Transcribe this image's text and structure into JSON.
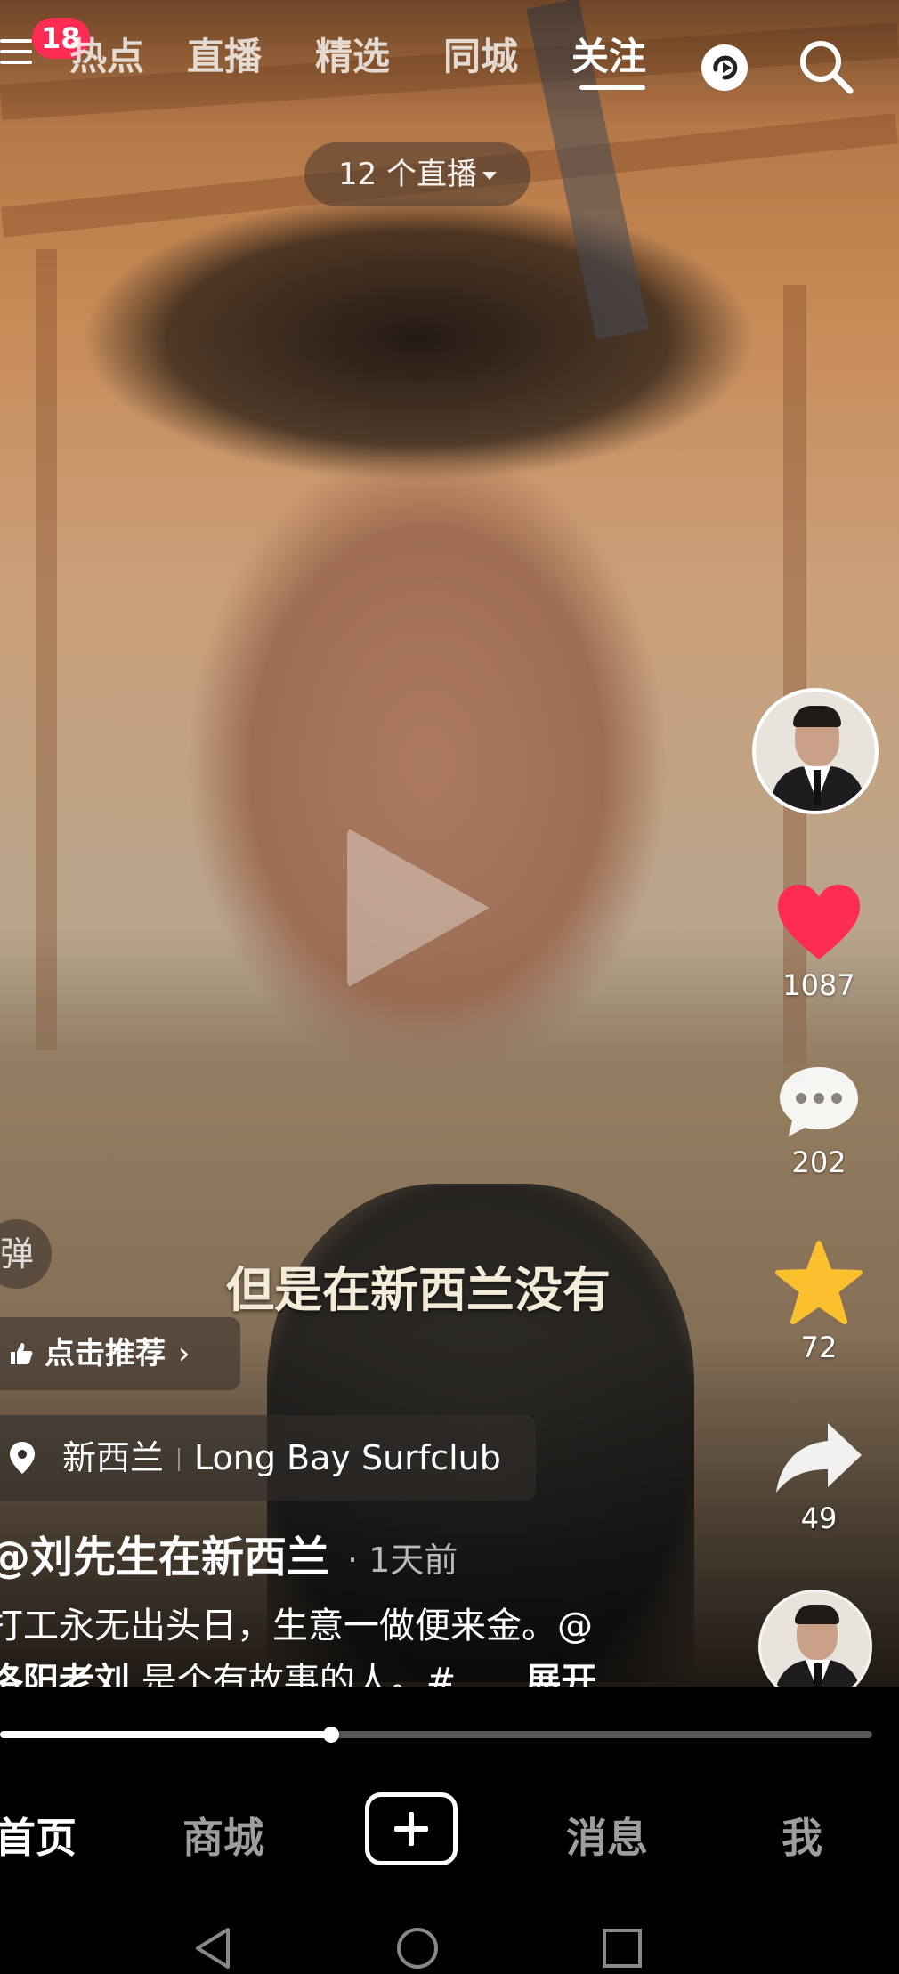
{
  "top_bar": {
    "notification_count": "18",
    "tabs": [
      {
        "label": "热点",
        "active": false
      },
      {
        "label": "直播",
        "active": false
      },
      {
        "label": "精选",
        "active": false
      },
      {
        "label": "同城",
        "active": false
      },
      {
        "label": "关注",
        "active": true
      }
    ],
    "icons": [
      "menu-icon",
      "swap-icon",
      "search-icon"
    ]
  },
  "live_pill": {
    "label": "12 个直播"
  },
  "video": {
    "subtitle": "但是在新西兰没有",
    "danmu_label": "弹",
    "progress": 0.38
  },
  "actions": {
    "likes": "1087",
    "comments": "202",
    "favorites": "72",
    "shares": "49"
  },
  "colors": {
    "like": "#fe2c55",
    "favorite": "#fbc02d",
    "badge": "#fe2c55"
  },
  "post": {
    "recommend_label": "点击推荐",
    "location_region": "新西兰",
    "location_place": "Long Bay Surfclub",
    "author": "@刘先生在新西兰",
    "time": "· 1天前",
    "desc_line1": "打工永无出头日，生意一做便来金。@",
    "desc_mention": "洛阳老刘",
    "desc_rest": " 是个有故事的人。#...",
    "expand_label": "展开"
  },
  "bottom_nav": {
    "home": "首页",
    "mall": "商城",
    "messages": "消息",
    "me": "我"
  }
}
